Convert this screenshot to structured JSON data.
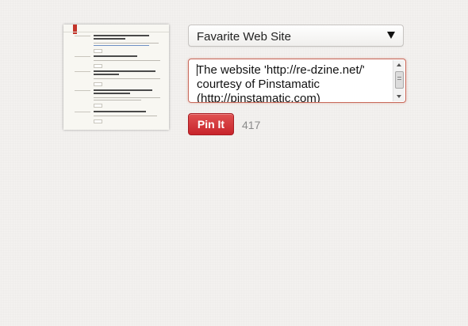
{
  "board_select": {
    "selected": "Favarite Web Site"
  },
  "description": {
    "text": "The website 'http://re-dzine.net/' courtesy of Pinstamatic (http://pinstamatic.com)"
  },
  "pin_button": {
    "label": "Pin It"
  },
  "repin_count": "417",
  "colors": {
    "pin_button": "#cb2027",
    "focus_border": "#c96a5b"
  },
  "icons": {
    "select_caret": "caret-down-icon"
  }
}
